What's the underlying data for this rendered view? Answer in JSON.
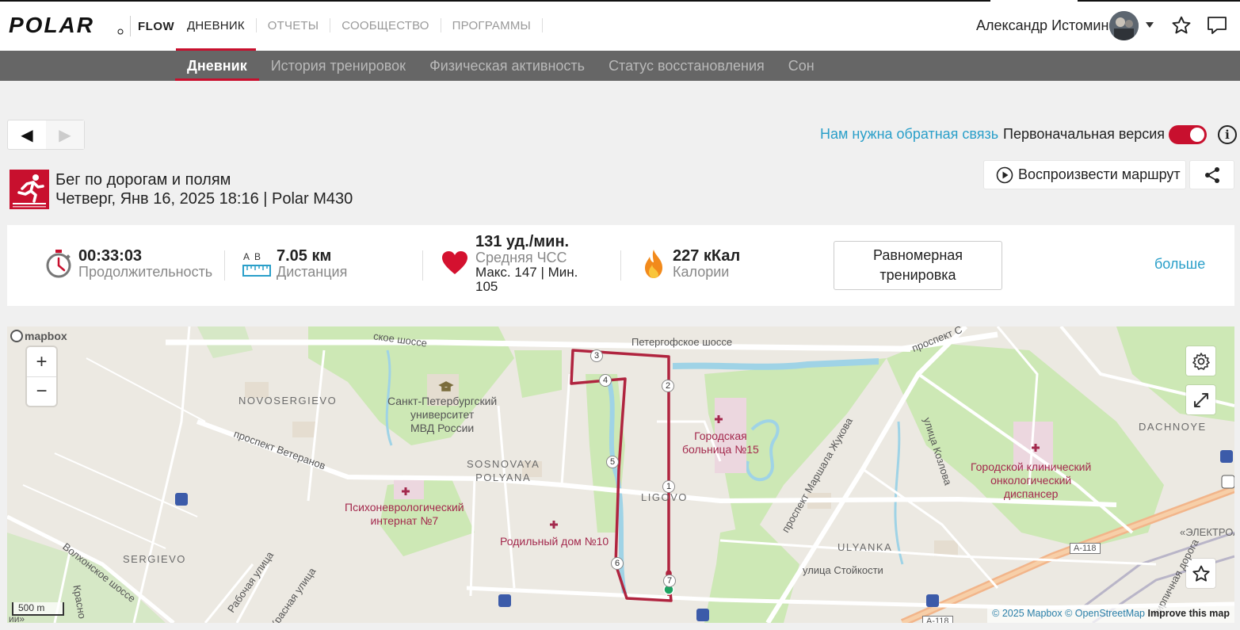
{
  "topnav": {
    "brand": "POLAR",
    "product": "FLOW",
    "items": [
      "ДНЕВНИК",
      "ОТЧЕТЫ",
      "СООБЩЕСТВО",
      "ПРОГРАММЫ"
    ],
    "active": "ДНЕВНИК",
    "user_name": "Александр Истомин"
  },
  "subnav": {
    "items": [
      "Дневник",
      "История тренировок",
      "Физическая активность",
      "Статус восстановления",
      "Сон"
    ],
    "active": "Дневник"
  },
  "toolbar": {
    "feedback_link": "Нам нужна обратная связь",
    "original_version_label": "Первоначальная версия",
    "original_version_on": true
  },
  "session": {
    "sport": "Бег по дорогам и полям",
    "datetime_device": "Четверг, Янв 16, 2025 18:16 | Polar M430",
    "replay_label": "Воспроизвести маршрут"
  },
  "stats": {
    "duration_value": "00:33:03",
    "duration_label": "Продолжительность",
    "distance_ab": "A  B",
    "distance_value": "7.05 км",
    "distance_label": "Дистанция",
    "hr_value": "131 уд./мин.",
    "hr_label": "Средняя ЧСС",
    "hr_minmax": "Макс. 147  |  Мин. 105",
    "calories_value": "227 кКал",
    "calories_label": "Калории",
    "training_type": "Равномерная тренировка",
    "more_link": "больше"
  },
  "map": {
    "provider": "mapbox",
    "zoom_in": "+",
    "zoom_out": "−",
    "scale": "500 m",
    "attribution_mapbox": "© 2025 Mapbox",
    "attribution_osm": "© OpenStreetMap",
    "improve": "Improve this map",
    "labels": {
      "road_petergof": "Петергофское шоссе",
      "road_petergof_left": "ское шоссе",
      "road_petergof_right": "проспект С",
      "novosergievo": "NOVOSERGIEVO",
      "prospekt_veteranov": "проспект Ветеранов",
      "sosnovaya": "SOSNOVAYA\nPOLYANA",
      "ligovo": "LIGOVO",
      "sergievo": "SERGIEVO",
      "volkhonskoe": "Волхонское шоссе",
      "krasnoe": "Красно",
      "rabochaya": "Рабочая улица",
      "krasnaya": "Красная улица",
      "university": "Санкт-Петербургский\nуниверситет\nМВД России",
      "psycho": "Психоневрологический\nинтернат №7",
      "maternity": "Родильный дом №10",
      "hospital15": "Городская\nбольница №15",
      "zhukova": "проспект Маршала Жукова",
      "kozlova": "улица Козлова",
      "oncology": "Городской клинический\nонкологический\nдиспансер",
      "dachnoye": "DACHNOYE",
      "ulyanka": "ULYANKA",
      "stoykosti": "улица Стойкости",
      "a118_1": "А-118",
      "a118_2": "А-118",
      "snt": "СНТ\n«ЭЛЕКТРОАППАР",
      "kirpichnaya": "Кирпичная дорога",
      "bottom_left": "ии»"
    },
    "waypoints": [
      "1",
      "2",
      "3",
      "4",
      "5",
      "6",
      "7"
    ],
    "colors": {
      "route": "#b0243f",
      "park": "#cde8b5",
      "water": "#9fd3e6",
      "road_major": "#ffffff",
      "highway": "#f2b58a"
    }
  }
}
